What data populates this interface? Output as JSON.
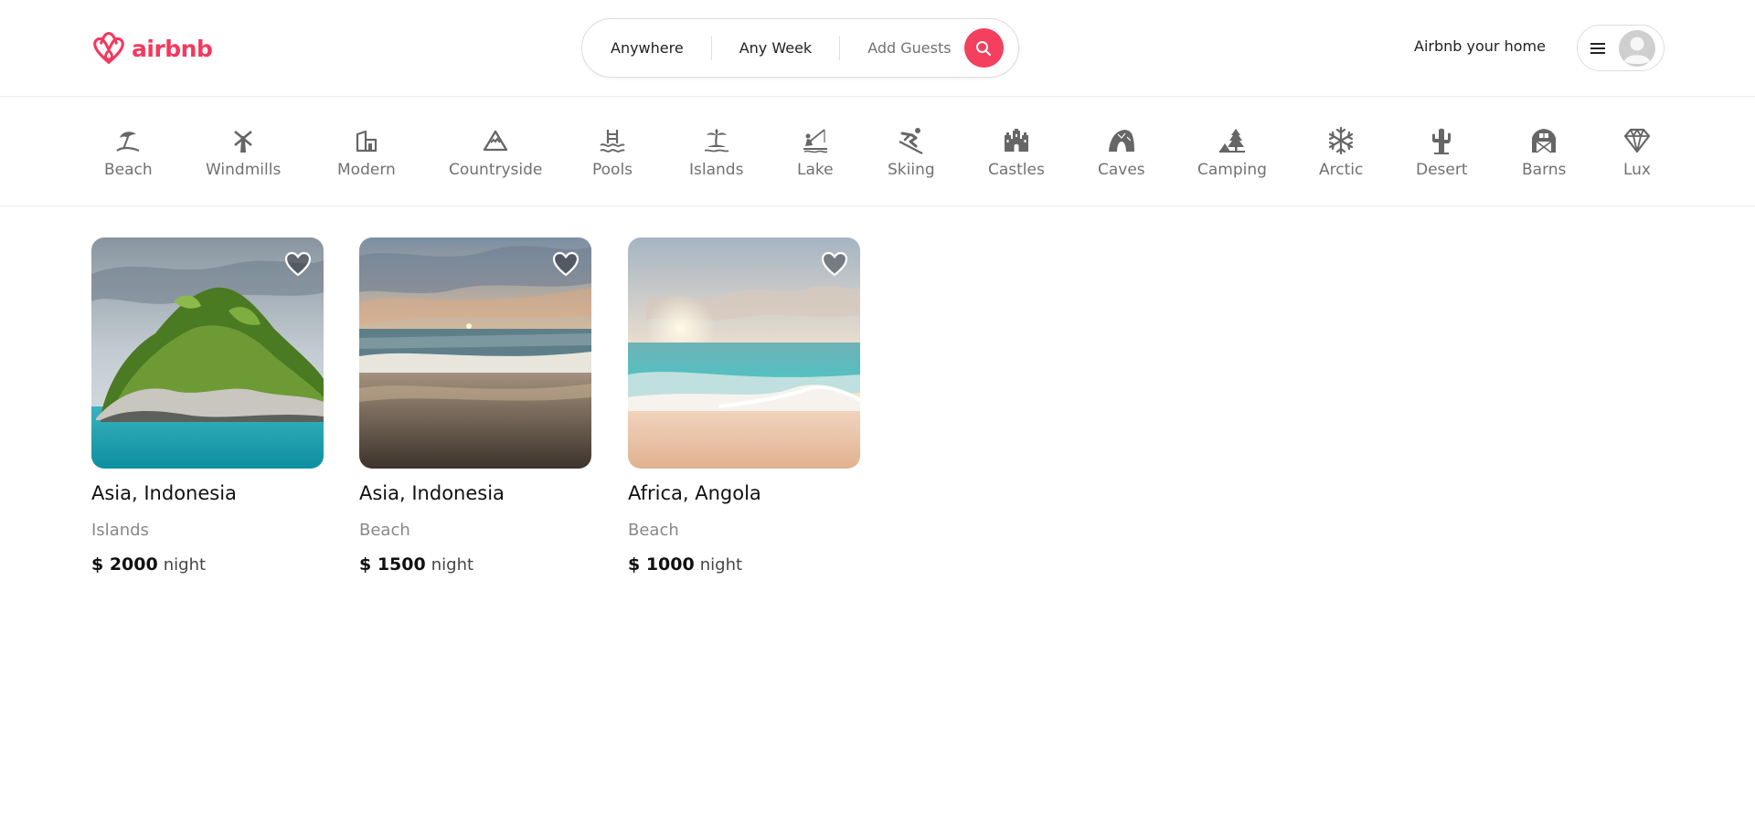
{
  "header": {
    "logo_text": "airbnb",
    "search": {
      "where": "Anywhere",
      "when": "Any Week",
      "guests": "Add Guests"
    },
    "host_link": "Airbnb your home",
    "brand_color": "#F43F5E"
  },
  "categories": [
    {
      "label": "Beach",
      "icon": "beach-umbrella-icon"
    },
    {
      "label": "Windmills",
      "icon": "windmill-icon"
    },
    {
      "label": "Modern",
      "icon": "modern-house-icon"
    },
    {
      "label": "Countryside",
      "icon": "mountain-icon"
    },
    {
      "label": "Pools",
      "icon": "pool-ladder-icon"
    },
    {
      "label": "Islands",
      "icon": "palm-island-icon"
    },
    {
      "label": "Lake",
      "icon": "fishing-lake-icon"
    },
    {
      "label": "Skiing",
      "icon": "skier-icon"
    },
    {
      "label": "Castles",
      "icon": "castle-icon"
    },
    {
      "label": "Caves",
      "icon": "cave-icon"
    },
    {
      "label": "Camping",
      "icon": "camping-tree-icon"
    },
    {
      "label": "Arctic",
      "icon": "snowflake-icon"
    },
    {
      "label": "Desert",
      "icon": "cactus-icon"
    },
    {
      "label": "Barns",
      "icon": "barn-icon"
    },
    {
      "label": "Lux",
      "icon": "diamond-icon"
    }
  ],
  "listings": [
    {
      "location": "Asia, Indonesia",
      "category": "Islands",
      "price": "$ 2000",
      "unit": "night",
      "photo": "island-rock-photo"
    },
    {
      "location": "Asia, Indonesia",
      "category": "Beach",
      "price": "$ 1500",
      "unit": "night",
      "photo": "sunset-beach-photo"
    },
    {
      "location": "Africa, Angola",
      "category": "Beach",
      "price": "$ 1000",
      "unit": "night",
      "photo": "tropical-beach-photo"
    }
  ]
}
